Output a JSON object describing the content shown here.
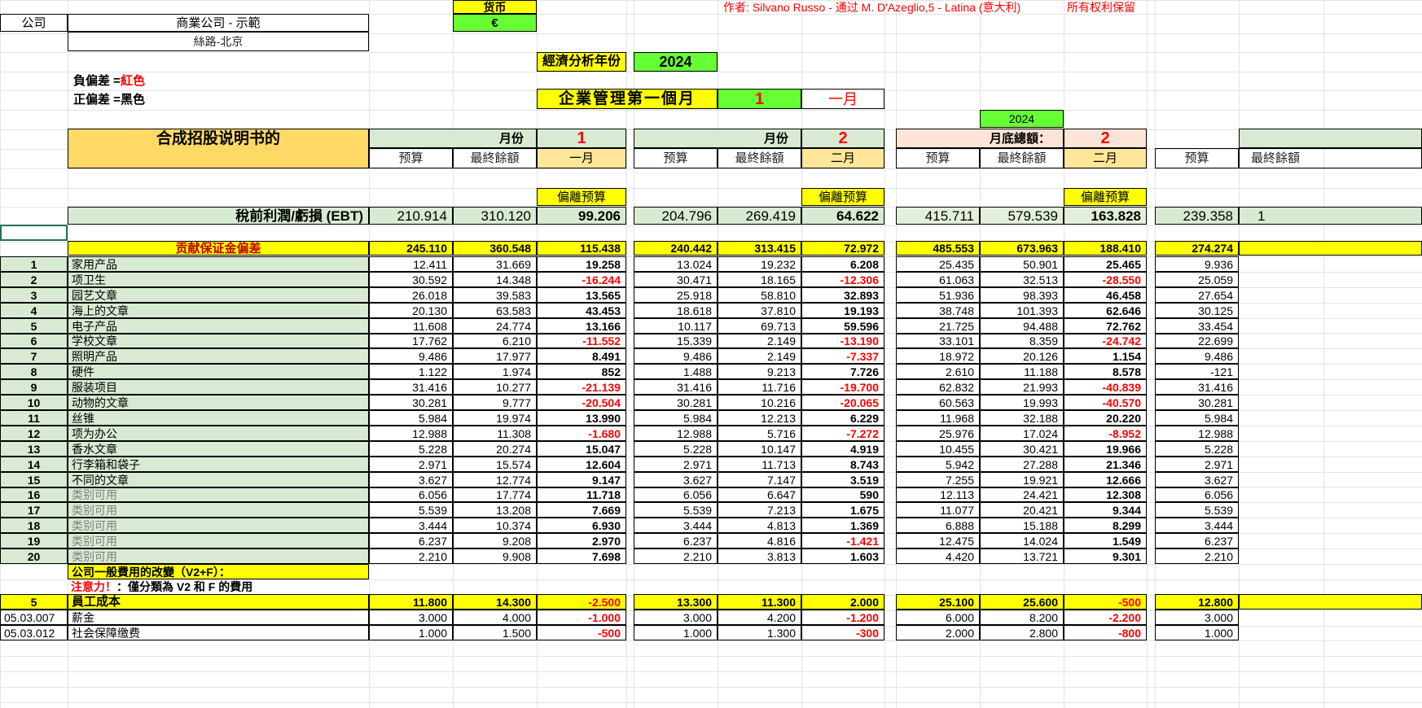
{
  "header": {
    "currency_label": "货币",
    "currency_value": "€",
    "author": "作者: Silvano Russo - 通过 M. D'Azeglio,5 - Latina (意大利)",
    "rights": "所有权利保留",
    "company_label": "公司",
    "company_name": "商業公司 - 示範",
    "address": "絲路-北京",
    "negative_label": "負偏差 = ",
    "negative_value": "紅色",
    "positive_label": "正偏差 = ",
    "positive_value": "黑色",
    "analysis_year_label": "經濟分析年份",
    "analysis_year": "2024",
    "first_month_label": "企業管理第一個月",
    "first_month_num": "1",
    "first_month_name": "一月",
    "ytd_year": "2024",
    "title": "合成招股说明书的"
  },
  "columns": {
    "month_label": "月份",
    "total_label": "月底總額：",
    "budget": "预算",
    "final": "最終餘額",
    "deviation": "偏離预算",
    "blocks": [
      {
        "num": "1",
        "month": "一月"
      },
      {
        "num": "2",
        "month": "二月"
      },
      {
        "num": "2",
        "month": "二月"
      }
    ]
  },
  "ebt": {
    "label": "稅前利潤/虧損 (EBT)",
    "values": [
      [
        "210.914",
        "310.120",
        "99.206"
      ],
      [
        "204.796",
        "269.419",
        "64.622"
      ],
      [
        "415.711",
        "579.539",
        "163.828"
      ]
    ],
    "partial": "239.358",
    "partial_cut": "1"
  },
  "contribution": {
    "label": "贡献保证金偏差",
    "values": [
      [
        "245.110",
        "360.548",
        "115.438"
      ],
      [
        "240.442",
        "313.415",
        "72.972"
      ],
      [
        "485.553",
        "673.963",
        "188.410"
      ]
    ],
    "partial": "274.274"
  },
  "rows": [
    {
      "num": "1",
      "name": "家用产品",
      "v": [
        [
          "12.411",
          "31.669",
          "19.258"
        ],
        [
          "13.024",
          "19.232",
          "6.208"
        ],
        [
          "25.435",
          "50.901",
          "25.465"
        ]
      ],
      "p": "9.936"
    },
    {
      "num": "2",
      "name": "项卫生",
      "v": [
        [
          "30.592",
          "14.348",
          "-16.244"
        ],
        [
          "30.471",
          "18.165",
          "-12.306"
        ],
        [
          "61.063",
          "32.513",
          "-28.550"
        ]
      ],
      "p": "25.059"
    },
    {
      "num": "3",
      "name": "园艺文章",
      "v": [
        [
          "26.018",
          "39.583",
          "13.565"
        ],
        [
          "25.918",
          "58.810",
          "32.893"
        ],
        [
          "51.936",
          "98.393",
          "46.458"
        ]
      ],
      "p": "27.654"
    },
    {
      "num": "4",
      "name": "海上的文章",
      "v": [
        [
          "20.130",
          "63.583",
          "43.453"
        ],
        [
          "18.618",
          "37.810",
          "19.193"
        ],
        [
          "38.748",
          "101.393",
          "62.646"
        ]
      ],
      "p": "30.125"
    },
    {
      "num": "5",
      "name": "电子产品",
      "v": [
        [
          "11.608",
          "24.774",
          "13.166"
        ],
        [
          "10.117",
          "69.713",
          "59.596"
        ],
        [
          "21.725",
          "94.488",
          "72.762"
        ]
      ],
      "p": "33.454"
    },
    {
      "num": "6",
      "name": "学校文章",
      "v": [
        [
          "17.762",
          "6.210",
          "-11.552"
        ],
        [
          "15.339",
          "2.149",
          "-13.190"
        ],
        [
          "33.101",
          "8.359",
          "-24.742"
        ]
      ],
      "p": "22.699"
    },
    {
      "num": "7",
      "name": "照明产品",
      "v": [
        [
          "9.486",
          "17.977",
          "8.491"
        ],
        [
          "9.486",
          "2.149",
          "-7.337"
        ],
        [
          "18.972",
          "20.126",
          "1.154"
        ]
      ],
      "p": "9.486"
    },
    {
      "num": "8",
      "name": "硬件",
      "v": [
        [
          "1.122",
          "1.974",
          "852"
        ],
        [
          "1.488",
          "9.213",
          "7.726"
        ],
        [
          "2.610",
          "11.188",
          "8.578"
        ]
      ],
      "p": "-121"
    },
    {
      "num": "9",
      "name": "服装项目",
      "v": [
        [
          "31.416",
          "10.277",
          "-21.139"
        ],
        [
          "31.416",
          "11.716",
          "-19.700"
        ],
        [
          "62.832",
          "21.993",
          "-40.839"
        ]
      ],
      "p": "31.416"
    },
    {
      "num": "10",
      "name": "动物的文章",
      "v": [
        [
          "30.281",
          "9.777",
          "-20.504"
        ],
        [
          "30.281",
          "10.216",
          "-20.065"
        ],
        [
          "60.563",
          "19.993",
          "-40.570"
        ]
      ],
      "p": "30.281"
    },
    {
      "num": "11",
      "name": "丝锥",
      "v": [
        [
          "5.984",
          "19.974",
          "13.990"
        ],
        [
          "5.984",
          "12.213",
          "6.229"
        ],
        [
          "11.968",
          "32.188",
          "20.220"
        ]
      ],
      "p": "5.984"
    },
    {
      "num": "12",
      "name": "项为办公",
      "v": [
        [
          "12.988",
          "11.308",
          "-1.680"
        ],
        [
          "12.988",
          "5.716",
          "-7.272"
        ],
        [
          "25.976",
          "17.024",
          "-8.952"
        ]
      ],
      "p": "12.988"
    },
    {
      "num": "13",
      "name": "香水文章",
      "v": [
        [
          "5.228",
          "20.274",
          "15.047"
        ],
        [
          "5.228",
          "10.147",
          "4.919"
        ],
        [
          "10.455",
          "30.421",
          "19.966"
        ]
      ],
      "p": "5.228"
    },
    {
      "num": "14",
      "name": "行李箱和袋子",
      "v": [
        [
          "2.971",
          "15.574",
          "12.604"
        ],
        [
          "2.971",
          "11.713",
          "8.743"
        ],
        [
          "5.942",
          "27.288",
          "21.346"
        ]
      ],
      "p": "2.971"
    },
    {
      "num": "15",
      "name": "不同的文章",
      "v": [
        [
          "3.627",
          "12.774",
          "9.147"
        ],
        [
          "3.627",
          "7.147",
          "3.519"
        ],
        [
          "7.255",
          "19.921",
          "12.666"
        ]
      ],
      "p": "3.627"
    },
    {
      "num": "16",
      "name": "类别可用",
      "v": [
        [
          "6.056",
          "17.774",
          "11.718"
        ],
        [
          "6.056",
          "6.647",
          "590"
        ],
        [
          "12.113",
          "24.421",
          "12.308"
        ]
      ],
      "p": "6.056"
    },
    {
      "num": "17",
      "name": "类别可用",
      "v": [
        [
          "5.539",
          "13.208",
          "7.669"
        ],
        [
          "5.539",
          "7.213",
          "1.675"
        ],
        [
          "11.077",
          "20.421",
          "9.344"
        ]
      ],
      "p": "5.539"
    },
    {
      "num": "18",
      "name": "类别可用",
      "v": [
        [
          "3.444",
          "10.374",
          "6.930"
        ],
        [
          "3.444",
          "4.813",
          "1.369"
        ],
        [
          "6.888",
          "15.188",
          "8.299"
        ]
      ],
      "p": "3.444"
    },
    {
      "num": "19",
      "name": "类别可用",
      "v": [
        [
          "6.237",
          "9.208",
          "2.970"
        ],
        [
          "6.237",
          "4.816",
          "-1.421"
        ],
        [
          "12.475",
          "14.024",
          "1.549"
        ]
      ],
      "p": "6.237"
    },
    {
      "num": "20",
      "name": "类别可用",
      "v": [
        [
          "2.210",
          "9.908",
          "7.698"
        ],
        [
          "2.210",
          "3.813",
          "1.603"
        ],
        [
          "4.420",
          "13.721",
          "9.301"
        ]
      ],
      "p": "2.210"
    }
  ],
  "general": {
    "label1": "公司一般費用的改變（V2+F）：",
    "label2a": "注意力！",
    "label2b": "：僅分類為 V2 和 F 的費用"
  },
  "staff": {
    "num": "5",
    "label": "員工成本",
    "values": [
      [
        "11.800",
        "14.300",
        "-2.500"
      ],
      [
        "13.300",
        "11.300",
        "2.000"
      ],
      [
        "25.100",
        "25.600",
        "-500"
      ]
    ],
    "partial": "12.800"
  },
  "subrows": [
    {
      "code": "05.03.007",
      "name": "薪金",
      "v": [
        [
          "3.000",
          "4.000",
          "-1.000"
        ],
        [
          "3.000",
          "4.200",
          "-1.200"
        ],
        [
          "6.000",
          "8.200",
          "-2.200"
        ]
      ],
      "p": "3.000"
    },
    {
      "code": "05.03.012",
      "name": "社会保障缴费",
      "v": [
        [
          "1.000",
          "1.500",
          "-500"
        ],
        [
          "1.000",
          "1.300",
          "-300"
        ],
        [
          "2.000",
          "2.800",
          "-800"
        ]
      ],
      "p": "1.000"
    }
  ]
}
